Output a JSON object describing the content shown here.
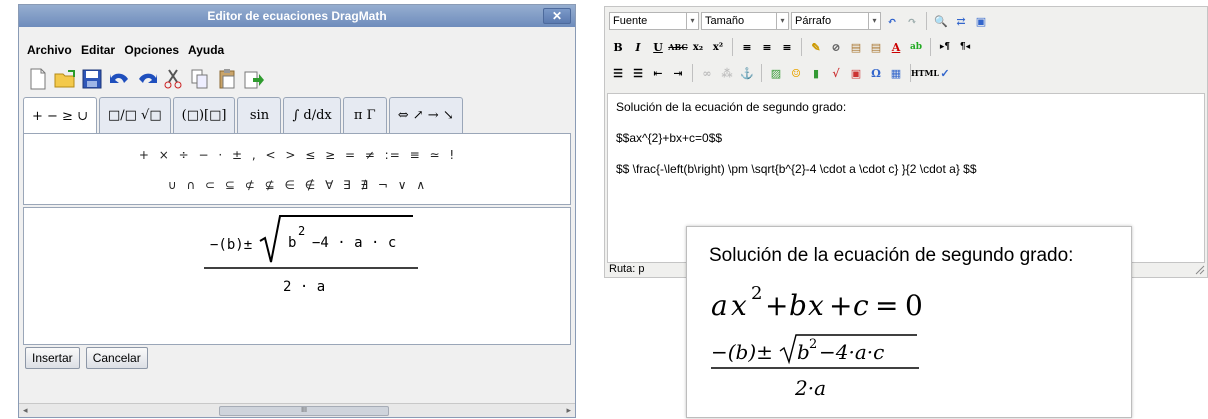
{
  "dragmath": {
    "title": "Editor de ecuaciones DragMath",
    "close_label": "✕",
    "menu": [
      "Archivo",
      "Editar",
      "Opciones",
      "Ayuda"
    ],
    "toolbar_icons": [
      "new-file-icon",
      "open-folder-icon",
      "save-icon",
      "undo-icon",
      "redo-icon",
      "cut-icon",
      "copy-icon",
      "paste-icon",
      "export-icon"
    ],
    "tabs": [
      "+ − ≥ ∪",
      "□/□ √□",
      "(□)[□]",
      "sin",
      "∫ d/dx",
      "π Γ",
      "⇔ ↗ → ↘"
    ],
    "symbols_row1": "+ × ÷ − · ± , < > ≤ ≥ = ≠ := ≡ ≃ !",
    "symbols_row2": "∪ ∩ ⊂ ⊆ ⊄ ⊈ ∈ ∉ ∀ ∃ ∄ ¬ ∨ ∧",
    "expr": {
      "num_prefix": "−(b)±",
      "radicand_b": "b",
      "exp": "2",
      "radicand_rest": "−4 · a · c",
      "denominator": "2 · a"
    },
    "insert_button": "Insertar",
    "cancel_button": "Cancelar",
    "scroll_grip": "III"
  },
  "editor": {
    "font_select": "Fuente",
    "size_select": "Tamaño",
    "format_select": "Párrafo",
    "line1": "Solución de la ecuación de segundo grado:",
    "line2": "$$ax^{2}+bx+c=0$$",
    "line3": "$$ \\frac{-\\left(b\\right) \\pm \\sqrt{b^{2}-4 \\cdot a \\cdot c} }{2 \\cdot a} $$",
    "path_label": "Ruta: p"
  },
  "rendered": {
    "heading": "Solución de la ecuación de segundo grado:",
    "eq1": {
      "a": "a",
      "x": "x",
      "two": "2",
      "plus1": "+",
      "b": "b",
      "x2": "x",
      "plus2": "+",
      "c": "c",
      "eq": "=",
      "zero": "0"
    },
    "eq2": {
      "num_prefix": "−(b)±",
      "radicand": "b",
      "exp": "2",
      "rest": "−4·a·c",
      "denominator": "2·a"
    }
  }
}
